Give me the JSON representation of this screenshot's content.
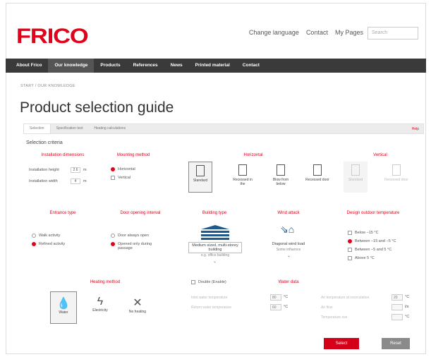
{
  "header": {
    "logo": "FRICO",
    "links": [
      "Change language",
      "Contact",
      "My Pages"
    ],
    "search_placeholder": "Search"
  },
  "nav": [
    "About Frico",
    "Our knowledge",
    "Products",
    "References",
    "News",
    "Printed material",
    "Contact"
  ],
  "breadcrumb": "START  /  OUR KNOWLEDGE",
  "page_title": "Product selection guide",
  "tabs": [
    "Selection",
    "Specification text",
    "Heating calculations"
  ],
  "tab_right": "Help",
  "section_label": "Selection criteria",
  "installation": {
    "heading": "Installation dimensions",
    "height_label": "Installation height",
    "height_value": "2.6",
    "height_unit": "m",
    "width_label": "Installation width",
    "width_value": "4",
    "width_unit": "m"
  },
  "mounting": {
    "heading": "Mounting method",
    "options": [
      "Horizontal",
      "Vertical"
    ]
  },
  "horizontal": {
    "heading": "Horizontal",
    "options": [
      "Standard",
      "Recessed in the",
      "Blow from below",
      "Recessed door"
    ]
  },
  "vertical": {
    "heading": "Vertical",
    "options": [
      "Standard",
      "Recessed door"
    ]
  },
  "entrance": {
    "heading": "Entrance type",
    "options": [
      "Walk activity",
      "Refined activity"
    ]
  },
  "door": {
    "heading": "Door opening interval",
    "options": [
      "Door always open",
      "Opened only during passage"
    ]
  },
  "building": {
    "heading": "Building type",
    "label": "Medium sized, multi-storey building",
    "sub": "e.g. office building"
  },
  "wind": {
    "heading": "Wind attack",
    "label": "Diagonal wind load",
    "sub": "Some influence"
  },
  "design_temp": {
    "heading": "Design outdoor temperature",
    "options": [
      "Below −15 °C",
      "Between −15 and −5 °C",
      "Between −5 and 5 °C",
      "Above 5 °C"
    ]
  },
  "heating": {
    "heading": "Heating method",
    "options": [
      "Water",
      "Electricity",
      "No heating"
    ]
  },
  "double_enable": "Double (Enable)",
  "water_data": {
    "heading": "Water data",
    "fields_left": [
      {
        "label": "Inlet water temperature",
        "value": "80",
        "unit": "°C"
      },
      {
        "label": "Return water temperature",
        "value": "60",
        "unit": "°C"
      }
    ],
    "fields_right": [
      {
        "label": "Air temperature at recirculation",
        "value": "20",
        "unit": "°C"
      },
      {
        "label": "Air flow",
        "value": "",
        "unit": "l/s"
      },
      {
        "label": "Temperature rise",
        "value": "",
        "unit": "°C"
      }
    ]
  },
  "buttons": {
    "select": "Select",
    "reset": "Reset"
  }
}
